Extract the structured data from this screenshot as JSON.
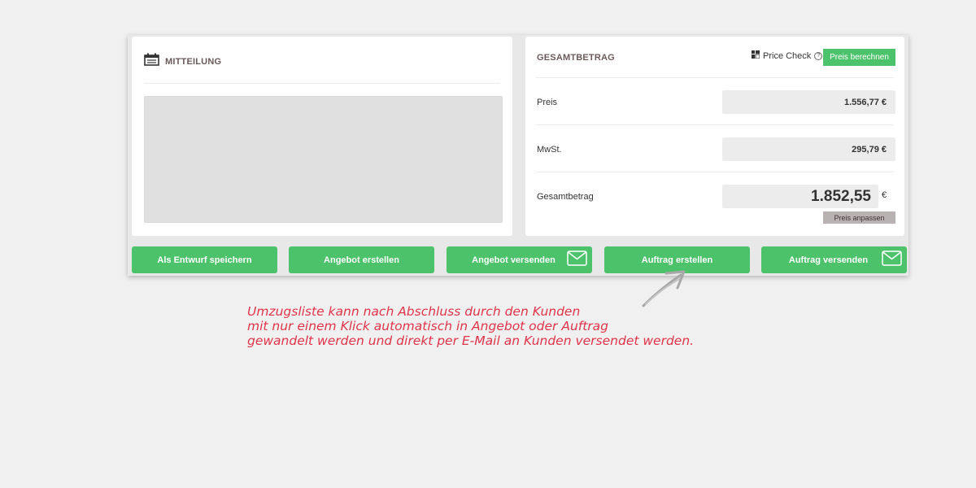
{
  "mitteilung": {
    "title": "MITTEILUNG",
    "icon": "calendar-icon"
  },
  "gesamtbetrag": {
    "title": "GESAMTBETRAG",
    "price_check_label": "Price Check",
    "price_check_icon": "grid-icon",
    "help_icon": "?",
    "calc_button": "Preis berechnen",
    "rows": [
      {
        "label": "Preis",
        "value": "1.556,77 €"
      },
      {
        "label": "MwSt.",
        "value": "295,79 €"
      },
      {
        "label": "Gesamtbetrag",
        "value": "1.852,55",
        "currency": "€"
      }
    ],
    "adjust_button": "Preis anpassen"
  },
  "actions": [
    {
      "label": "Als Entwurf speichern",
      "icon": null
    },
    {
      "label": "Angebot erstellen",
      "icon": null
    },
    {
      "label": "Angebot versenden",
      "icon": "envelope-icon"
    },
    {
      "label": "Auftrag erstellen",
      "icon": null
    },
    {
      "label": "Auftrag versenden",
      "icon": "envelope-icon"
    }
  ],
  "annotation": {
    "lines": [
      "Umzugsliste kann nach Abschluss durch den Kunden",
      "mit nur einem Klick automatisch in Angebot oder Auftrag",
      "gewandelt werden und direkt per E-Mail an Kunden versendet werden."
    ]
  },
  "colors": {
    "green": "#4cc26a",
    "annotation": "#e0344a",
    "title": "#6b5a5a"
  }
}
